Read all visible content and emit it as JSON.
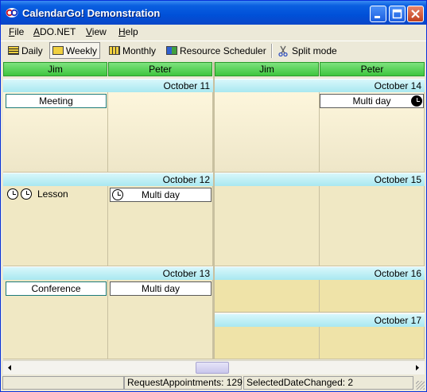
{
  "window": {
    "title": "CalendarGo! Demonstration"
  },
  "menu": [
    {
      "label": "File"
    },
    {
      "label": "ADO.NET"
    },
    {
      "label": "View"
    },
    {
      "label": "Help"
    }
  ],
  "toolbar": {
    "daily": "Daily",
    "weekly": "Weekly",
    "monthly": "Monthly",
    "resource_scheduler": "Resource Scheduler",
    "split_mode": "Split mode",
    "active_view": "Weekly"
  },
  "resources": [
    "Jim",
    "Peter",
    "Jim",
    "Peter"
  ],
  "days": {
    "oct11": "October 11",
    "oct12": "October 12",
    "oct13": "October 13",
    "oct14": "October 14",
    "oct15": "October 15",
    "oct16": "October 16",
    "oct17": "October 17"
  },
  "appointments": {
    "meeting": "Meeting",
    "multiday_oct14": "Multi day",
    "lesson": "Lesson",
    "multiday_oct12": "Multi day",
    "conference": "Conference",
    "multiday_oct13": "Multi day"
  },
  "status": {
    "request_appointments": "RequestAppointments: 129",
    "selected_date_changed": "SelectedDateChanged: 2"
  },
  "colors": {
    "title_bar": "#0050d8",
    "resource_header": "#5fd65f",
    "day_header": "#bdeff5",
    "cell_fill": "#f6eed0"
  }
}
